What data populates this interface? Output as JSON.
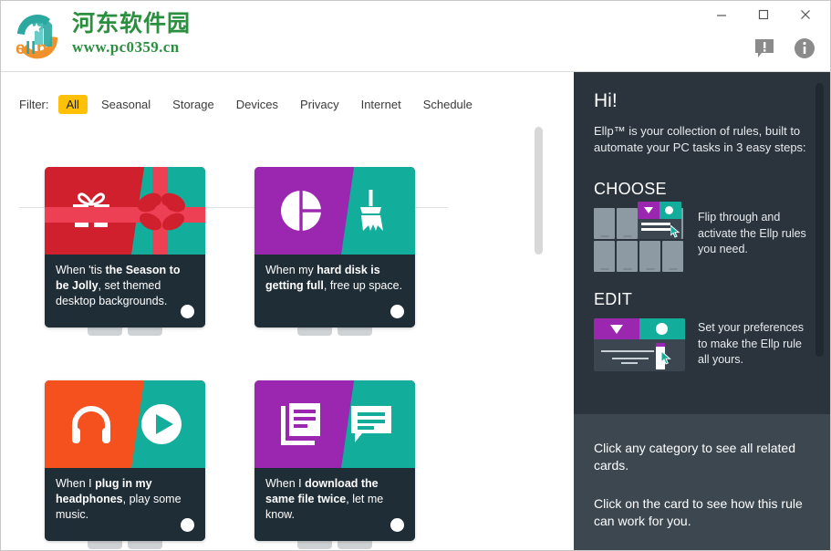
{
  "window": {
    "minimize_label": "Minimize",
    "maximize_label": "Maximize",
    "close_label": "Close"
  },
  "branding": {
    "logo_text": "ellp",
    "site_name_cn": "河东软件园",
    "site_url": "www.pc0359.cn"
  },
  "topbar": {
    "feedback_icon": "feedback-icon",
    "info_icon": "info-icon"
  },
  "filter": {
    "label": "Filter:",
    "items": [
      {
        "label": "All",
        "active": true
      },
      {
        "label": "Seasonal",
        "active": false
      },
      {
        "label": "Storage",
        "active": false
      },
      {
        "label": "Devices",
        "active": false
      },
      {
        "label": "Privacy",
        "active": false
      },
      {
        "label": "Internet",
        "active": false
      },
      {
        "label": "Schedule",
        "active": false
      }
    ],
    "active_color": "#FFC107"
  },
  "cards": [
    {
      "id": "seasonal-backgrounds",
      "text_pre": "When 'tis ",
      "text_bold": "the Season to be Jolly",
      "text_post": ", set themed desktop backgrounds.",
      "left_color": "#D0202E",
      "right_color": "#12AD9B",
      "ribbon_color": "#EE4054",
      "left_icon": "gift-icon",
      "right_icon": "ribbon-bow-icon",
      "toggle": "off"
    },
    {
      "id": "hard-disk-cleanup",
      "text_pre": "When my ",
      "text_bold": "hard disk is getting full",
      "text_post": ", free up space.",
      "left_color": "#9B27B0",
      "right_color": "#12AD9B",
      "left_icon": "disk-usage-pie-icon",
      "right_icon": "broom-icon",
      "toggle": "off"
    },
    {
      "id": "headphones-music",
      "text_pre": "When I ",
      "text_bold": "plug in my headphones",
      "text_post": ", play some music.",
      "left_color": "#F4511E",
      "right_color": "#12AD9B",
      "left_icon": "headphones-icon",
      "right_icon": "play-circle-icon",
      "toggle": "off"
    },
    {
      "id": "duplicate-download",
      "text_pre": "When I ",
      "text_bold": "download the same file twice",
      "text_post": ", let me know.",
      "left_color": "#9B27B0",
      "right_color": "#12AD9B",
      "left_icon": "copy-documents-icon",
      "right_icon": "speech-bubble-icon",
      "toggle": "off"
    }
  ],
  "sidebar": {
    "greeting": "Hi!",
    "intro": "Ellp™ is your collection of rules, built to automate your PC tasks in 3 easy steps:",
    "steps": [
      {
        "title": "CHOOSE",
        "description": "Flip through and activate the Ellp rules you need.",
        "illustration": "card-grid-illustration"
      },
      {
        "title": "EDIT",
        "description": "Set your preferences to make the Ellp rule all yours.",
        "illustration": "card-settings-illustration"
      }
    ],
    "hints": [
      "Click any category to see all related cards.",
      "Click on the card to see how this rule can work for you."
    ],
    "bg_color": "#2b333c",
    "bottom_bg_color": "#3c4750"
  },
  "scrollbars": {
    "main_thumb": "main-scroll-thumb",
    "sidebar_thumb": "sidebar-scroll-thumb"
  }
}
